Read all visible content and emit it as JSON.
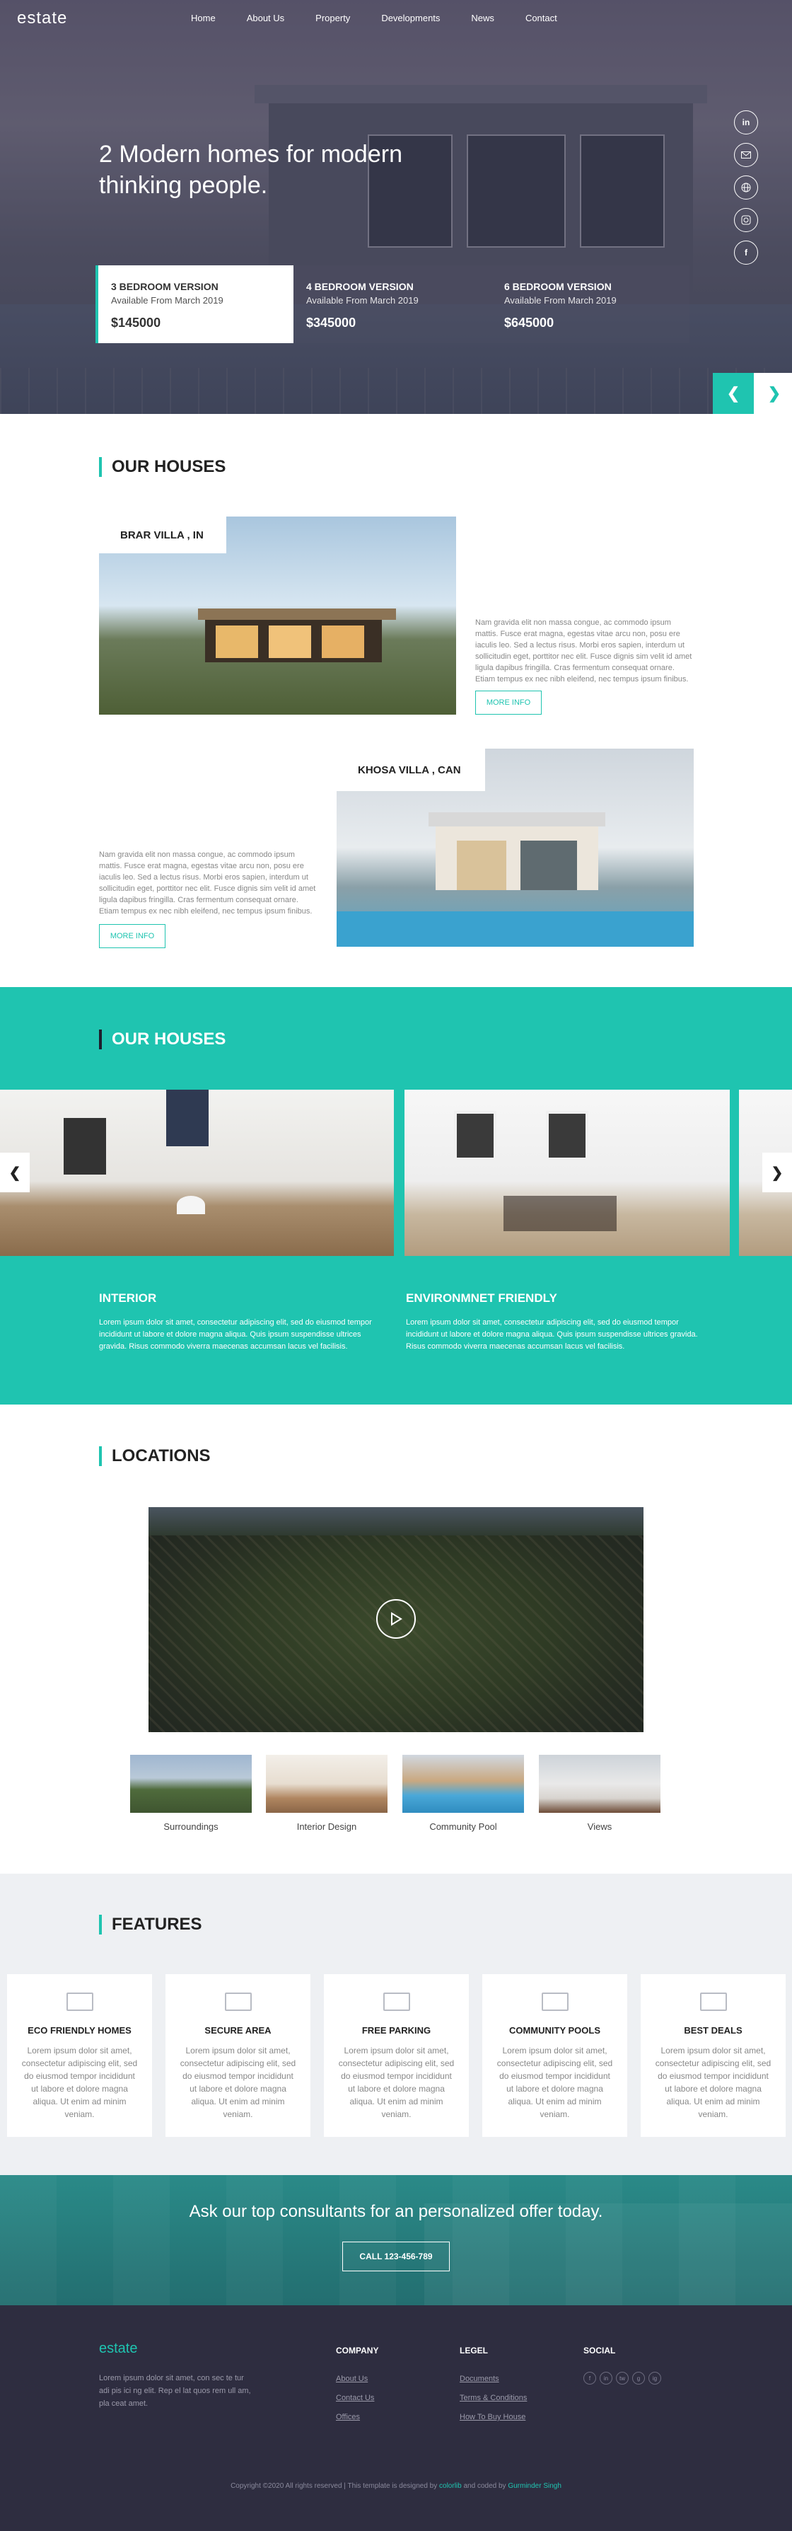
{
  "brand": {
    "logo": "estate",
    "accent": "#1fc4b0"
  },
  "nav": {
    "items": [
      "Home",
      "About Us",
      "Property",
      "Developments",
      "News",
      "Contact"
    ]
  },
  "hero": {
    "title": "2 Modern homes for modern thinking people.",
    "social": [
      "in",
      "mail",
      "global",
      "instagram",
      "f"
    ],
    "versions": [
      {
        "title": "3 BEDROOM VERSION",
        "available": "Available From March 2019",
        "price": "$145000"
      },
      {
        "title": "4 BEDROOM VERSION",
        "available": "Available From March 2019",
        "price": "$345000"
      },
      {
        "title": "6 BEDROOM VERSION",
        "available": "Available From March 2019",
        "price": "$645000"
      }
    ],
    "prev_icon": "chevron-left-icon",
    "next_icon": "chevron-right-icon"
  },
  "houses": {
    "heading": "OUR HOUSES",
    "items": [
      {
        "name": "BRAR VILLA , IN",
        "text": "Nam gravida elit non massa congue, ac commodo ipsum mattis. Fusce erat magna, egestas vitae arcu non, posu ere iaculis leo. Sed a lectus risus. Morbi eros sapien, interdum ut sollicitudin eget, porttitor nec elit. Fusce dignis sim velit id amet ligula dapibus fringilla. Cras fermentum consequat ornare. Etiam tempus ex nec nibh eleifend, nec tempus ipsum finibus.",
        "button": "MORE INFO"
      },
      {
        "name": "KHOSA VILLA , CAN",
        "text": "Nam gravida elit non massa congue, ac commodo ipsum mattis. Fusce erat magna, egestas vitae arcu non, posu ere iaculis leo. Sed a lectus risus. Morbi eros sapien, interdum ut sollicitudin eget, porttitor nec elit. Fusce dignis sim velit id amet ligula dapibus fringilla. Cras fermentum consequat ornare. Etiam tempus ex nec nibh eleifend, nec tempus ipsum finibus.",
        "button": "MORE INFO"
      }
    ]
  },
  "houses2": {
    "heading": "OUR HOUSES",
    "features": [
      {
        "title": "INTERIOR",
        "text": "Lorem ipsum dolor sit amet, consectetur adipiscing elit, sed do eiusmod tempor incididunt ut labore et dolore magna aliqua. Quis ipsum suspendisse ultrices gravida. Risus commodo viverra maecenas accumsan lacus vel facilisis."
      },
      {
        "title": "ENVIRONMNET FRIENDLY",
        "text": "Lorem ipsum dolor sit amet, consectetur adipiscing elit, sed do eiusmod tempor incididunt ut labore et dolore magna aliqua. Quis ipsum suspendisse ultrices gravida. Risus commodo viverra maecenas accumsan lacus vel facilisis."
      }
    ]
  },
  "locations": {
    "heading": "LOCATIONS",
    "play_icon": "play-icon",
    "thumbs": [
      "Surroundings",
      "Interior Design",
      "Community Pool",
      "Views"
    ]
  },
  "features": {
    "heading": "FEATURES",
    "cards": [
      {
        "title": "ECO FRIENDLY HOMES",
        "text": "Lorem ipsum dolor sit amet, consectetur adipiscing elit, sed do eiusmod tempor incididunt ut labore et dolore magna aliqua. Ut enim ad minim veniam."
      },
      {
        "title": "SECURE AREA",
        "text": "Lorem ipsum dolor sit amet, consectetur adipiscing elit, sed do eiusmod tempor incididunt ut labore et dolore magna aliqua. Ut enim ad minim veniam."
      },
      {
        "title": "FREE PARKING",
        "text": "Lorem ipsum dolor sit amet, consectetur adipiscing elit, sed do eiusmod tempor incididunt ut labore et dolore magna aliqua. Ut enim ad minim veniam."
      },
      {
        "title": "COMMUNITY POOLS",
        "text": "Lorem ipsum dolor sit amet, consectetur adipiscing elit, sed do eiusmod tempor incididunt ut labore et dolore magna aliqua. Ut enim ad minim veniam."
      },
      {
        "title": "BEST DEALS",
        "text": "Lorem ipsum dolor sit amet, consectetur adipiscing elit, sed do eiusmod tempor incididunt ut labore et dolore magna aliqua. Ut enim ad minim veniam."
      }
    ]
  },
  "cta": {
    "text": "Ask our top consultants for an personalized offer today.",
    "button": "CALL 123-456-789"
  },
  "footer": {
    "logo": "estate",
    "about": "Lorem ipsum dolor sit amet, con sec te tur adi pis ici ng elit. Rep el lat quos rem ull am, pla ceat amet.",
    "company": {
      "heading": "COMPANY",
      "links": [
        "About Us",
        "Contact Us",
        "Offices"
      ]
    },
    "legal": {
      "heading": "LEGEL",
      "links": [
        "Documents",
        "Terms & Conditions",
        "How To Buy House"
      ]
    },
    "social": {
      "heading": "SOCIAL",
      "icons": [
        "f",
        "in",
        "tw",
        "g",
        "ig"
      ]
    },
    "copyright_pre": "Copyright ©2020 All rights reserved | This template is designed by",
    "designer": "colorlib",
    "coded_by": "and coded by",
    "coder": "Gurminder Singh"
  }
}
